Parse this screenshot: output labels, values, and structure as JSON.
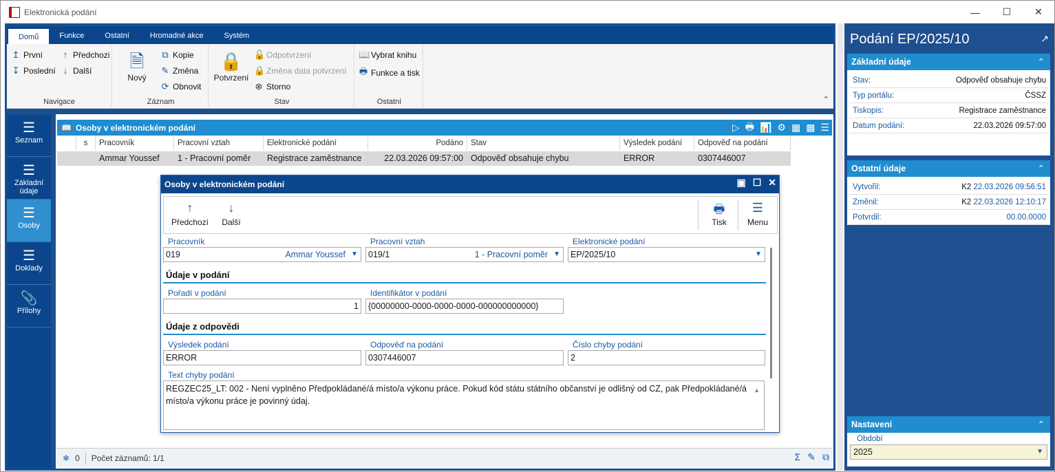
{
  "window": {
    "title": "Elektronická podání"
  },
  "ribbon": {
    "tabs": [
      "Domů",
      "Funkce",
      "Ostatní",
      "Hromadné akce",
      "Systém"
    ],
    "navigace": {
      "title": "Navigace",
      "prvni": "První",
      "posledni": "Poslední",
      "predchozi": "Předchozi",
      "dalsi": "Další"
    },
    "zaznam": {
      "title": "Záznam",
      "novy": "Nový",
      "kopie": "Kopie",
      "zmena": "Změna",
      "obnovit": "Obnovit"
    },
    "stav": {
      "title": "Stav",
      "potvrzeni": "Potvrzení",
      "odpotvrzeni": "Odpotvrzení",
      "zmena_data": "Změna data potvrzení",
      "storno": "Storno"
    },
    "ostatni": {
      "title": "Ostatní",
      "vybrat_knihu": "Vybrat knihu",
      "funkce_tisk": "Funkce a tisk"
    }
  },
  "leftnav": [
    {
      "label": "Seznam",
      "icon": "hamburger-icon"
    },
    {
      "label": "Základní údaje",
      "icon": "list-icon"
    },
    {
      "label": "Osoby",
      "icon": "list-icon"
    },
    {
      "label": "Doklady",
      "icon": "list-icon"
    },
    {
      "label": "Přílohy",
      "icon": "paperclip-icon"
    }
  ],
  "grid": {
    "title": "Osoby v elektronickém podání",
    "columns": [
      "",
      "s",
      "Pracovník",
      "Pracovní vztah",
      "Elektronické podání",
      "Podáno",
      "Stav",
      "Výsledek podání",
      "Odpověď na podání"
    ],
    "row": [
      "",
      "",
      "Ammar Youssef",
      "1 - Pracovní poměr",
      "Registrace zaměstnance",
      "22.03.2026 09:57:00",
      "Odpověď obsahuje chybu",
      "ERROR",
      "0307446007"
    ]
  },
  "status": {
    "filter_count": "0",
    "record_count": "Počet záznamů: 1/1"
  },
  "dialog": {
    "title": "Osoby v elektronickém podání",
    "toolbar": {
      "predchozi": "Předchozí",
      "dalsi": "Další",
      "tisk": "Tisk",
      "menu": "Menu"
    },
    "pracovnik": {
      "label": "Pracovník",
      "code": "019",
      "name": "Ammar Youssef"
    },
    "pracovni_vztah": {
      "label": "Pracovní vztah",
      "code": "019/1",
      "name": "1 - Pracovní poměr"
    },
    "elektronicke_podani": {
      "label": "Elektronické podání",
      "value": "EP/2025/10"
    },
    "section1": "Údaje v podání",
    "poradi": {
      "label": "Pořadí v podání",
      "value": "1"
    },
    "identifikator": {
      "label": "Identifikátor v podání",
      "value": "{00000000-0000-0000-0000-000000000000}"
    },
    "section2": "Údaje z odpovědi",
    "vysledek": {
      "label": "Výsledek podání",
      "value": "ERROR"
    },
    "odpoved": {
      "label": "Odpověď na podání",
      "value": "0307446007"
    },
    "cislo_chyby": {
      "label": "Číslo chyby podání",
      "value": "2"
    },
    "text_chyby": {
      "label": "Text chyby podání",
      "value": "REGZEC25_LT: 002 - Není vyplněno Předpokládané/á místo/a výkonu práce. Pokud kód státu státního občanství je odlišný od CZ, pak Předpokládané/á místo/a výkonu práce je povinný údaj."
    }
  },
  "rightpanel": {
    "title": "Podání EP/2025/10",
    "zakladni": {
      "title": "Základní údaje",
      "rows": [
        {
          "k": "Stav:",
          "v": "Odpověď obsahuje chybu"
        },
        {
          "k": "Typ portálu:",
          "v": "ČSSZ"
        },
        {
          "k": "Tiskopis:",
          "v": "Registrace zaměstnance"
        },
        {
          "k": "Datum podání:",
          "v": "22.03.2026 09:57:00"
        }
      ]
    },
    "ostatni": {
      "title": "Ostatní údaje",
      "rows": [
        {
          "k": "Vytvořil:",
          "user": "K2",
          "d": "22.03.2026 09:56:51"
        },
        {
          "k": "Změnil:",
          "user": "K2",
          "d": "22.03.2026 12:10:17"
        },
        {
          "k": "Potvrdil:",
          "user": "",
          "d": "00.00.0000"
        }
      ]
    },
    "nastaveni": {
      "title": "Nastavení",
      "obdobi_label": "Období",
      "obdobi_value": "2025"
    }
  }
}
